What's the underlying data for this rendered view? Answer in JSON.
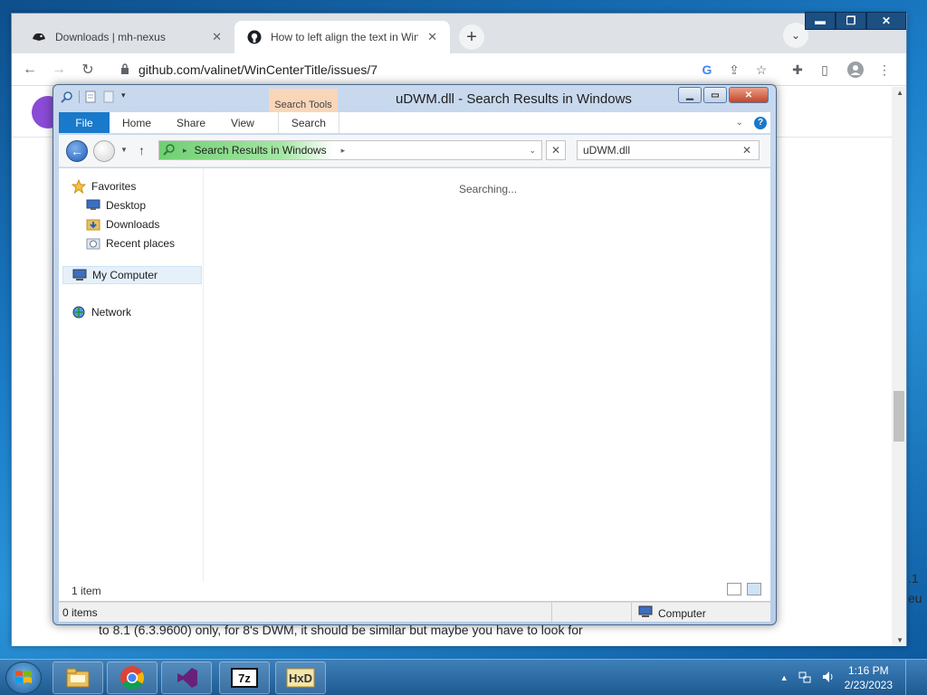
{
  "chrome": {
    "tabs": [
      {
        "title": "Downloads | mh-nexus",
        "close": "✕"
      },
      {
        "title": "How to left align the text in Winc",
        "close": "✕"
      }
    ],
    "new_tab": "+",
    "url": "github.com/valinet/WinCenterTitle/issues/7",
    "window_buttons": {
      "minimize": "▬",
      "maximize": "❐",
      "close": "✕"
    }
  },
  "github_page": {
    "body_text": "to 8.1 (6.3.9600) only, for 8's DWM, it should be similar but maybe you have to look for",
    "side_text_1": ".1",
    "side_text_2": "eu"
  },
  "explorer": {
    "title": "uDWM.dll - Search Results in Windows",
    "contextual_tab": "Search Tools",
    "ribbon_tabs": [
      "File",
      "Home",
      "Share",
      "View",
      "Search"
    ],
    "address_path": "Search Results in Windows",
    "search_query": "uDWM.dll",
    "nav": {
      "favorites": "Favorites",
      "desktop": "Desktop",
      "downloads": "Downloads",
      "recent": "Recent places",
      "computer": "My Computer",
      "network": "Network"
    },
    "status_message": "Searching...",
    "pane_count": "1 item",
    "status_items": "0 items",
    "status_location": "Computer"
  },
  "taskbar": {
    "apps": [
      "Windows Explorer",
      "Google Chrome",
      "Visual Studio",
      "7-Zip",
      "HxD"
    ],
    "time": "1:16 PM",
    "date": "2/23/2023"
  },
  "colors": {
    "explorer_file_tab": "#1979ca",
    "search_tools_tab": "#f9d6b8",
    "path_highlight": "#6fcf72",
    "taskbar": "#1d5a92"
  }
}
